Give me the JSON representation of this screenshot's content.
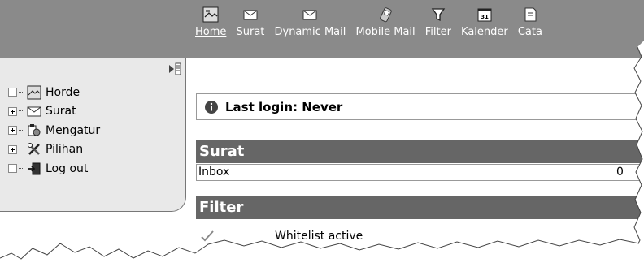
{
  "nav": {
    "items": [
      {
        "label": "Home",
        "icon": "home-icon"
      },
      {
        "label": "Surat",
        "icon": "mail-icon"
      },
      {
        "label": "Dynamic Mail",
        "icon": "mail-icon"
      },
      {
        "label": "Mobile Mail",
        "icon": "mobile-icon"
      },
      {
        "label": "Filter",
        "icon": "filter-icon"
      },
      {
        "label": "Kalender",
        "icon": "calendar-icon"
      },
      {
        "label": "Cata",
        "icon": "notes-icon"
      }
    ],
    "calendar_day": "31"
  },
  "sidebar": {
    "items": [
      {
        "label": "Horde",
        "icon": "home-icon"
      },
      {
        "label": "Surat",
        "icon": "mail-icon"
      },
      {
        "label": "Mengatur",
        "icon": "organize-icon"
      },
      {
        "label": "Pilihan",
        "icon": "tools-icon"
      },
      {
        "label": "Log out",
        "icon": "logout-icon"
      }
    ]
  },
  "notice": {
    "text": "Last login: Never"
  },
  "mail": {
    "title": "Surat",
    "rows": [
      {
        "folder": "Inbox",
        "count": "0"
      }
    ]
  },
  "filter": {
    "title": "Filter",
    "rows": [
      {
        "label": "Whitelist active"
      }
    ]
  },
  "colors": {
    "topbar": "#8a8a8a",
    "section_header": "#666666",
    "sidebar_bg": "#e9e9e9"
  }
}
